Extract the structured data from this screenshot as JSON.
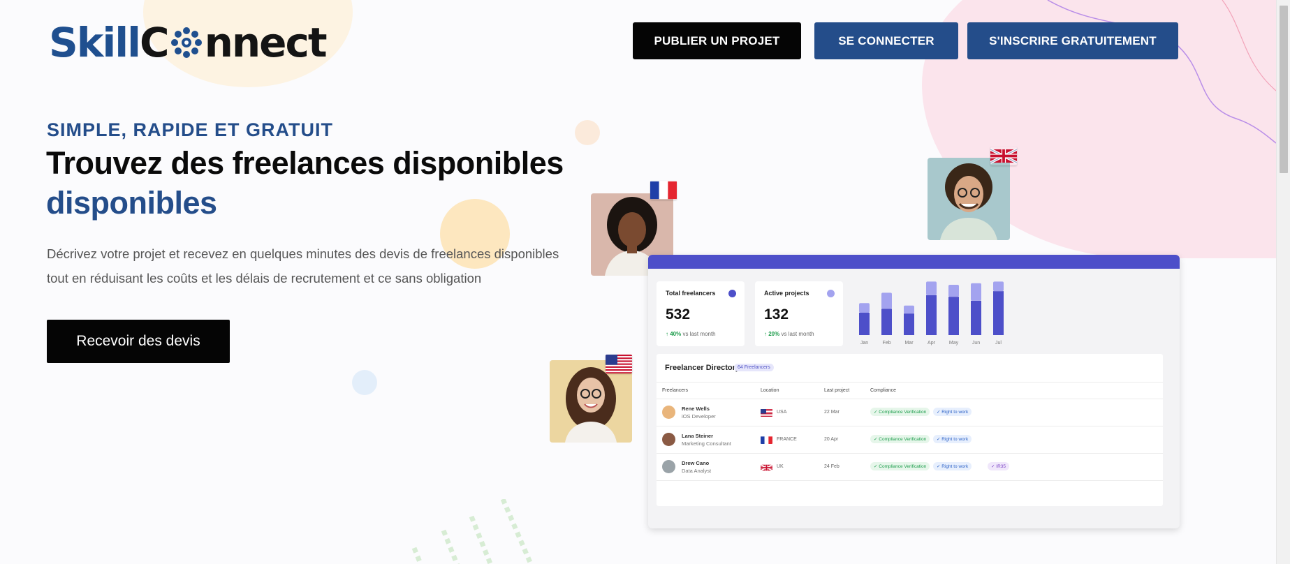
{
  "header": {
    "logo_part1": "Skill",
    "logo_part2": "C",
    "logo_part3": "nnect",
    "buttons": {
      "publish": "PUBLIER UN PROJET",
      "login": "SE CONNECTER",
      "signup": "S'INSCRIRE GRATUITEMENT"
    }
  },
  "hero": {
    "kicker": "SIMPLE, RAPIDE ET GRATUIT",
    "title_line1": "Trouvez des freelances disponibles",
    "title_line2": "disponibles",
    "description_line1": "Décrivez votre projet et recevez en quelques minutes des devis de freelances disponibles",
    "description_line2": "tout en réduisant les coûts et les délais de recrutement et ce sans obligation",
    "cta": "Recevoir des devis"
  },
  "dashboard": {
    "stats": [
      {
        "label": "Total freelancers",
        "value": "532",
        "delta": "40%",
        "delta_suffix": "vs last month",
        "dot_color": "#4d4fc9"
      },
      {
        "label": "Active projects",
        "value": "132",
        "delta": "20%",
        "delta_suffix": "vs last month",
        "dot_color": "#a3a3ef"
      }
    ],
    "directory": {
      "title": "Freelancer Directory",
      "badge": "64 Freelancers",
      "columns": [
        "Freelancers",
        "Location",
        "Last project",
        "Compliance"
      ],
      "rows": [
        {
          "name": "Rene Wells",
          "role": "iOS Developer",
          "location": "USA",
          "last_project": "22 Mar",
          "tags": [
            "Compliance Verification",
            "Right to work"
          ]
        },
        {
          "name": "Lana Steiner",
          "role": "Marketing Consultant",
          "location": "FRANCE",
          "last_project": "20 Apr",
          "tags": [
            "Compliance Verification",
            "Right to work"
          ]
        },
        {
          "name": "Drew Cano",
          "role": "Data Analyst",
          "location": "UK",
          "last_project": "24 Feb",
          "tags": [
            "Compliance Verification",
            "Right to work",
            "IR35"
          ]
        }
      ]
    }
  },
  "chart_data": {
    "type": "bar",
    "categories": [
      "Jan",
      "Feb",
      "Mar",
      "Apr",
      "May",
      "Jun",
      "Jul"
    ],
    "series": [
      {
        "values": [
          28,
          33,
          27,
          50,
          48,
          43,
          55
        ]
      },
      {
        "values": [
          12,
          20,
          10,
          17,
          15,
          22,
          12
        ]
      }
    ],
    "ylim": [
      0,
      70
    ],
    "colors": [
      "#4d4fc9",
      "#a3a3ef"
    ]
  },
  "colors": {
    "brand_blue": "#244d8a",
    "black": "#050505",
    "dashboard_accent": "#4d4fc9"
  }
}
